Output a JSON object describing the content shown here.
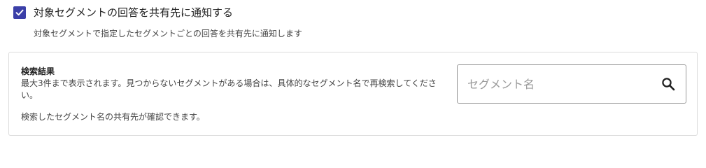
{
  "notify_checkbox": {
    "checked": true,
    "label": "対象セグメントの回答を共有先に通知する",
    "icon": "check-icon"
  },
  "helper_text": "対象セグメントで指定したセグメントごとの回答を共有先に通知します",
  "search_results": {
    "title": "検索結果",
    "description": "最大3件まで表示されます。見つからないセグメントがある場合は、具体的なセグメント名で再検索してください。",
    "note": "検索したセグメント名の共有先が確認できます。"
  },
  "segment_search": {
    "value": "",
    "placeholder": "セグメント名",
    "icon": "search-icon"
  },
  "colors": {
    "accent": "#3b3fa8",
    "border": "#dcdcdc",
    "input_border": "#9a9a9a",
    "text": "#222222",
    "muted_text": "#444444",
    "placeholder": "#9a9a9a"
  }
}
